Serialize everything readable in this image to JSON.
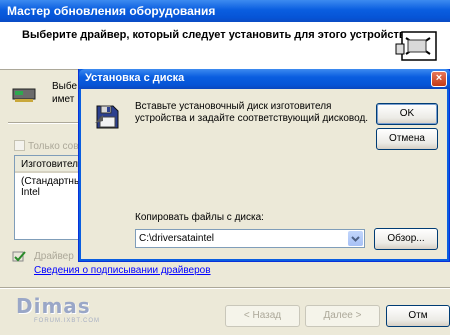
{
  "wizard": {
    "title": "Мастер обновления оборудования",
    "header": "Выберите драйвер, который следует установить для этого устройства.",
    "device_text_line1": "Выбе",
    "device_text_line2": "имет",
    "compat_label": "Только сов",
    "list_header": "Изготовител",
    "list_rows": [
      "(Стандартны",
      "Intel"
    ],
    "sign_text": "Драйвер",
    "sign_link": "Сведения о подписывании драйверов",
    "logo": "Dimas",
    "logo_sub": "FORUM.IXBT.COM",
    "back_button": "< Назад",
    "next_button": "Далее >",
    "cancel_stub": "Отм"
  },
  "dialog": {
    "title": "Установка с диска",
    "close_label": "×",
    "message_line1": "Вставьте установочный диск изготовителя",
    "message_line2": "устройства и задайте соответствующий дисковод.",
    "ok_button": "OK",
    "cancel_button": "Отмена",
    "copy_label": "Копировать файлы с диска:",
    "path_value": "C:\\driversataintel",
    "browse_button": "Обзор..."
  },
  "icons": {
    "wizard_header": "hardware-wizard-icon",
    "device": "device-card-icon",
    "dialog": "floppy-disk-icon",
    "sign": "signed-driver-icon",
    "dropdown": "chevron-down-icon"
  }
}
